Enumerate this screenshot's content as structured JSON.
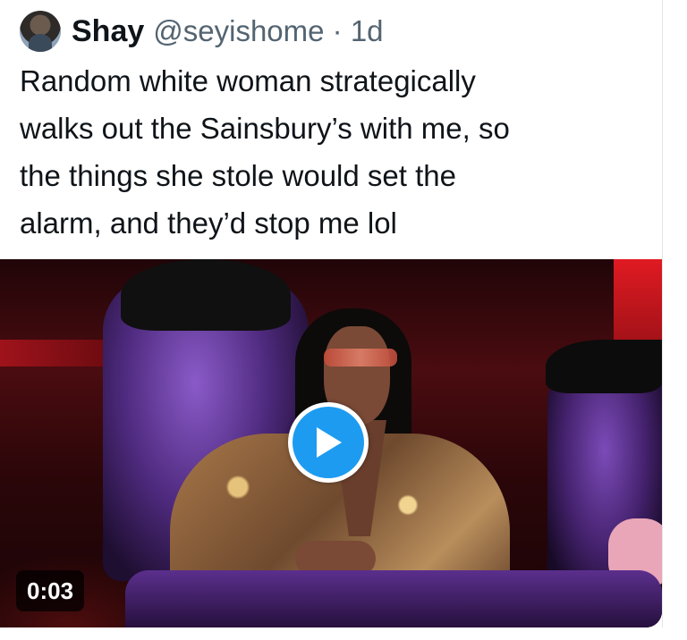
{
  "tweet": {
    "author_name": "Shay",
    "author_handle": "@seyishome",
    "separator": " · ",
    "time_ago": "1d",
    "text": "Random white woman strategically\nwalks out the Sainsbury’s with me, so\nthe things she stole would set the\nalarm, and they’d stop me lol"
  },
  "media": {
    "type": "video",
    "duration": "0:03",
    "play_icon": "play-icon"
  },
  "colors": {
    "accent": "#1d9bf0",
    "text_primary": "#0f1419",
    "text_secondary": "#536471"
  }
}
